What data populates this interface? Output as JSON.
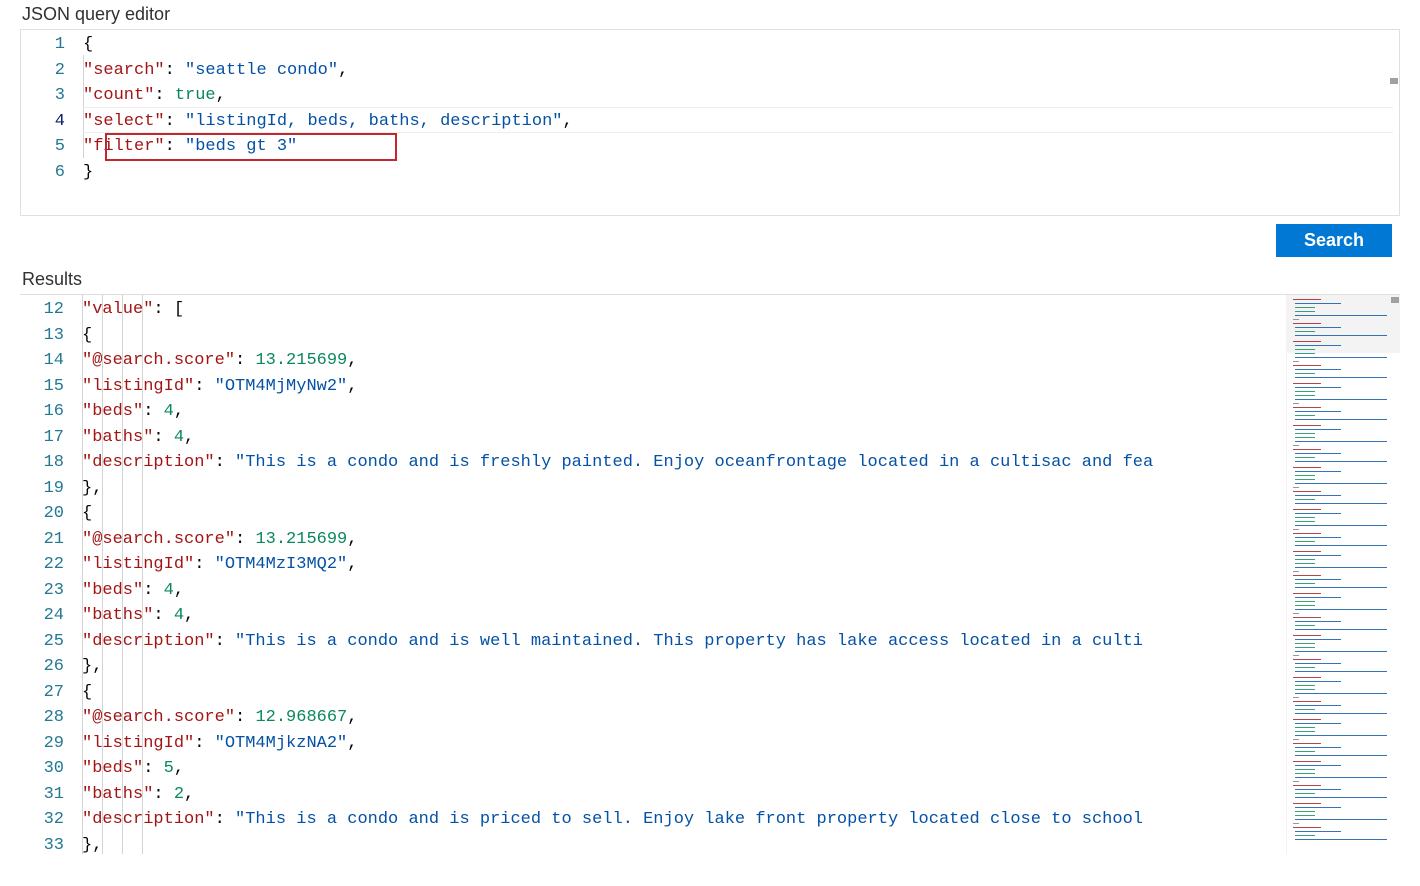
{
  "labels": {
    "editor": "JSON query editor",
    "results": "Results",
    "search": "Search"
  },
  "colors": {
    "accent": "#0078d4",
    "highlight_border": "#c1272d"
  },
  "query_editor": {
    "active_line": 4,
    "lines": [
      {
        "no": 1,
        "tokens": [
          {
            "t": "{",
            "c": "punc"
          }
        ]
      },
      {
        "no": 2,
        "tokens": [
          {
            "t": "   "
          },
          {
            "t": "\"search\"",
            "c": "key"
          },
          {
            "t": ": ",
            "c": "punc"
          },
          {
            "t": "\"seattle condo\"",
            "c": "str"
          },
          {
            "t": ",",
            "c": "punc"
          }
        ]
      },
      {
        "no": 3,
        "tokens": [
          {
            "t": "   "
          },
          {
            "t": "\"count\"",
            "c": "key"
          },
          {
            "t": ": ",
            "c": "punc"
          },
          {
            "t": "true",
            "c": "bool"
          },
          {
            "t": ",",
            "c": "punc"
          }
        ]
      },
      {
        "no": 4,
        "tokens": [
          {
            "t": "   "
          },
          {
            "t": "\"select\"",
            "c": "key"
          },
          {
            "t": ": ",
            "c": "punc"
          },
          {
            "t": "\"listingId, beds, baths, description\"",
            "c": "str"
          },
          {
            "t": ",",
            "c": "punc"
          }
        ]
      },
      {
        "no": 5,
        "tokens": [
          {
            "t": "   "
          },
          {
            "t": "\"filter\"",
            "c": "key"
          },
          {
            "t": ": ",
            "c": "punc"
          },
          {
            "t": "\"beds gt 3\"",
            "c": "str"
          }
        ]
      },
      {
        "no": 6,
        "tokens": [
          {
            "t": "}",
            "c": "punc"
          }
        ]
      }
    ],
    "highlight_line": 5
  },
  "results": {
    "start": 12,
    "lines": [
      {
        "no": 12,
        "depth": 1,
        "tokens": [
          {
            "t": "\"value\"",
            "c": "key"
          },
          {
            "t": ": [",
            "c": "punc"
          }
        ]
      },
      {
        "no": 13,
        "depth": 2,
        "tokens": [
          {
            "t": "{",
            "c": "punc"
          }
        ]
      },
      {
        "no": 14,
        "depth": 3,
        "tokens": [
          {
            "t": "\"@search.score\"",
            "c": "key"
          },
          {
            "t": ": ",
            "c": "punc"
          },
          {
            "t": "13.215699",
            "c": "num"
          },
          {
            "t": ",",
            "c": "punc"
          }
        ]
      },
      {
        "no": 15,
        "depth": 3,
        "tokens": [
          {
            "t": "\"listingId\"",
            "c": "key"
          },
          {
            "t": ": ",
            "c": "punc"
          },
          {
            "t": "\"OTM4MjMyNw2\"",
            "c": "str"
          },
          {
            "t": ",",
            "c": "punc"
          }
        ]
      },
      {
        "no": 16,
        "depth": 3,
        "tokens": [
          {
            "t": "\"beds\"",
            "c": "key"
          },
          {
            "t": ": ",
            "c": "punc"
          },
          {
            "t": "4",
            "c": "num"
          },
          {
            "t": ",",
            "c": "punc"
          }
        ]
      },
      {
        "no": 17,
        "depth": 3,
        "tokens": [
          {
            "t": "\"baths\"",
            "c": "key"
          },
          {
            "t": ": ",
            "c": "punc"
          },
          {
            "t": "4",
            "c": "num"
          },
          {
            "t": ",",
            "c": "punc"
          }
        ]
      },
      {
        "no": 18,
        "depth": 3,
        "tokens": [
          {
            "t": "\"description\"",
            "c": "key"
          },
          {
            "t": ": ",
            "c": "punc"
          },
          {
            "t": "\"This is a condo and is freshly painted.  Enjoy oceanfrontage located in a cultisac and fea",
            "c": "str"
          }
        ]
      },
      {
        "no": 19,
        "depth": 2,
        "tokens": [
          {
            "t": "},",
            "c": "punc"
          }
        ]
      },
      {
        "no": 20,
        "depth": 2,
        "tokens": [
          {
            "t": "{",
            "c": "punc"
          }
        ]
      },
      {
        "no": 21,
        "depth": 3,
        "tokens": [
          {
            "t": "\"@search.score\"",
            "c": "key"
          },
          {
            "t": ": ",
            "c": "punc"
          },
          {
            "t": "13.215699",
            "c": "num"
          },
          {
            "t": ",",
            "c": "punc"
          }
        ]
      },
      {
        "no": 22,
        "depth": 3,
        "tokens": [
          {
            "t": "\"listingId\"",
            "c": "key"
          },
          {
            "t": ": ",
            "c": "punc"
          },
          {
            "t": "\"OTM4MzI3MQ2\"",
            "c": "str"
          },
          {
            "t": ",",
            "c": "punc"
          }
        ]
      },
      {
        "no": 23,
        "depth": 3,
        "tokens": [
          {
            "t": "\"beds\"",
            "c": "key"
          },
          {
            "t": ": ",
            "c": "punc"
          },
          {
            "t": "4",
            "c": "num"
          },
          {
            "t": ",",
            "c": "punc"
          }
        ]
      },
      {
        "no": 24,
        "depth": 3,
        "tokens": [
          {
            "t": "\"baths\"",
            "c": "key"
          },
          {
            "t": ": ",
            "c": "punc"
          },
          {
            "t": "4",
            "c": "num"
          },
          {
            "t": ",",
            "c": "punc"
          }
        ]
      },
      {
        "no": 25,
        "depth": 3,
        "tokens": [
          {
            "t": "\"description\"",
            "c": "key"
          },
          {
            "t": ": ",
            "c": "punc"
          },
          {
            "t": "\"This is a condo and is well maintained.  This property has lake access located in a culti",
            "c": "str"
          }
        ]
      },
      {
        "no": 26,
        "depth": 2,
        "tokens": [
          {
            "t": "},",
            "c": "punc"
          }
        ]
      },
      {
        "no": 27,
        "depth": 2,
        "tokens": [
          {
            "t": "{",
            "c": "punc"
          }
        ]
      },
      {
        "no": 28,
        "depth": 3,
        "tokens": [
          {
            "t": "\"@search.score\"",
            "c": "key"
          },
          {
            "t": ": ",
            "c": "punc"
          },
          {
            "t": "12.968667",
            "c": "num"
          },
          {
            "t": ",",
            "c": "punc"
          }
        ]
      },
      {
        "no": 29,
        "depth": 3,
        "tokens": [
          {
            "t": "\"listingId\"",
            "c": "key"
          },
          {
            "t": ": ",
            "c": "punc"
          },
          {
            "t": "\"OTM4MjkzNA2\"",
            "c": "str"
          },
          {
            "t": ",",
            "c": "punc"
          }
        ]
      },
      {
        "no": 30,
        "depth": 3,
        "tokens": [
          {
            "t": "\"beds\"",
            "c": "key"
          },
          {
            "t": ": ",
            "c": "punc"
          },
          {
            "t": "5",
            "c": "num"
          },
          {
            "t": ",",
            "c": "punc"
          }
        ]
      },
      {
        "no": 31,
        "depth": 3,
        "tokens": [
          {
            "t": "\"baths\"",
            "c": "key"
          },
          {
            "t": ": ",
            "c": "punc"
          },
          {
            "t": "2",
            "c": "num"
          },
          {
            "t": ",",
            "c": "punc"
          }
        ]
      },
      {
        "no": 32,
        "depth": 3,
        "tokens": [
          {
            "t": "\"description\"",
            "c": "key"
          },
          {
            "t": ": ",
            "c": "punc"
          },
          {
            "t": "\"This is a condo and is priced to sell.  Enjoy lake front property located close to school",
            "c": "str"
          }
        ]
      },
      {
        "no": 33,
        "depth": 2,
        "tokens": [
          {
            "t": "},",
            "c": "punc"
          }
        ]
      }
    ]
  }
}
